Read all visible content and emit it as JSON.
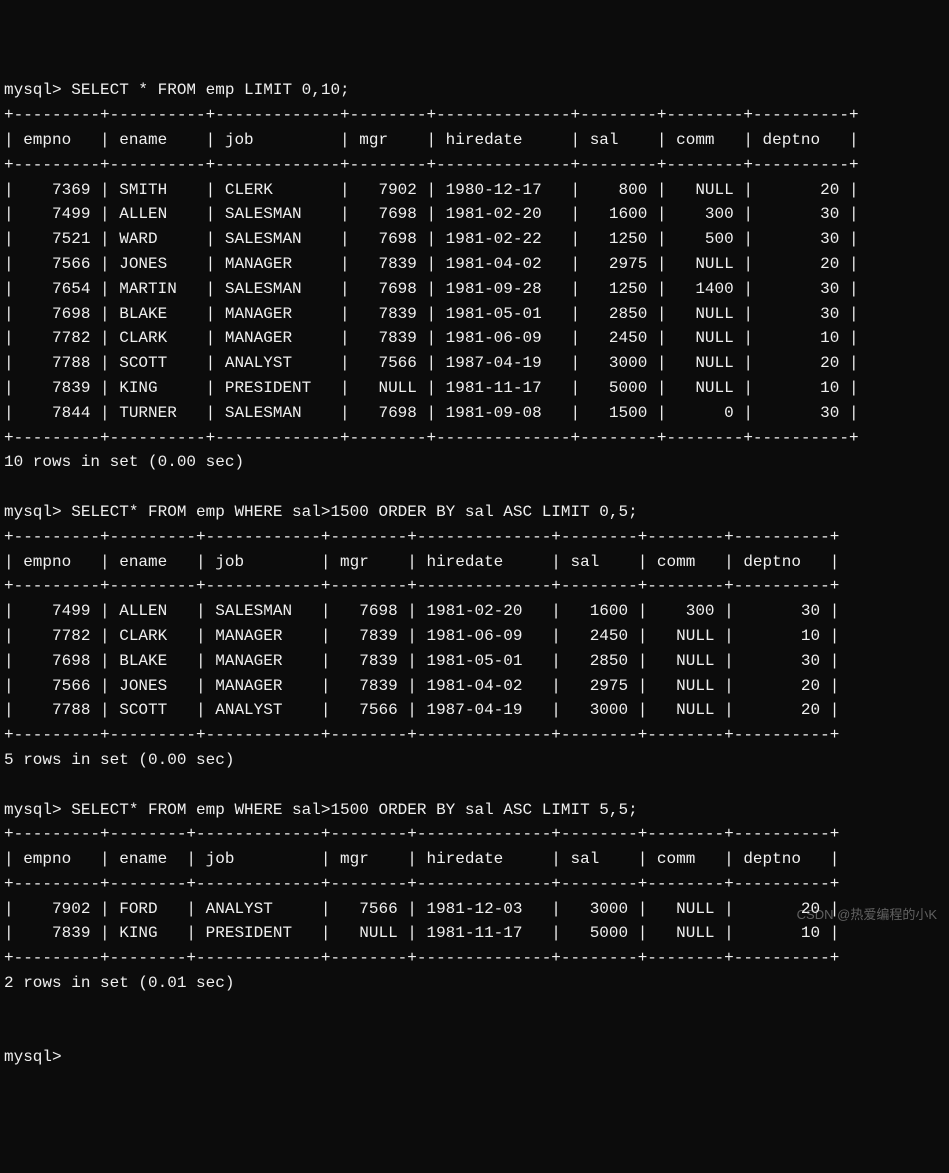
{
  "prompt": "mysql>",
  "queries": [
    {
      "sql": "SELECT * FROM emp LIMIT 0,10;",
      "headers": [
        "empno",
        "ename",
        "job",
        "mgr",
        "hiredate",
        "sal",
        "comm",
        "deptno"
      ],
      "widths": [
        7,
        8,
        11,
        6,
        12,
        6,
        6,
        8
      ],
      "aligns": [
        "r",
        "l",
        "l",
        "r",
        "l",
        "r",
        "r",
        "r"
      ],
      "rows": [
        [
          "7369",
          "SMITH",
          "CLERK",
          "7902",
          "1980-12-17",
          "800",
          "NULL",
          "20"
        ],
        [
          "7499",
          "ALLEN",
          "SALESMAN",
          "7698",
          "1981-02-20",
          "1600",
          "300",
          "30"
        ],
        [
          "7521",
          "WARD",
          "SALESMAN",
          "7698",
          "1981-02-22",
          "1250",
          "500",
          "30"
        ],
        [
          "7566",
          "JONES",
          "MANAGER",
          "7839",
          "1981-04-02",
          "2975",
          "NULL",
          "20"
        ],
        [
          "7654",
          "MARTIN",
          "SALESMAN",
          "7698",
          "1981-09-28",
          "1250",
          "1400",
          "30"
        ],
        [
          "7698",
          "BLAKE",
          "MANAGER",
          "7839",
          "1981-05-01",
          "2850",
          "NULL",
          "30"
        ],
        [
          "7782",
          "CLARK",
          "MANAGER",
          "7839",
          "1981-06-09",
          "2450",
          "NULL",
          "10"
        ],
        [
          "7788",
          "SCOTT",
          "ANALYST",
          "7566",
          "1987-04-19",
          "3000",
          "NULL",
          "20"
        ],
        [
          "7839",
          "KING",
          "PRESIDENT",
          "NULL",
          "1981-11-17",
          "5000",
          "NULL",
          "10"
        ],
        [
          "7844",
          "TURNER",
          "SALESMAN",
          "7698",
          "1981-09-08",
          "1500",
          "0",
          "30"
        ]
      ],
      "footer": "10 rows in set (0.00 sec)"
    },
    {
      "sql": "SELECT* FROM emp WHERE sal>1500 ORDER BY sal ASC LIMIT 0,5;",
      "headers": [
        "empno",
        "ename",
        "job",
        "mgr",
        "hiredate",
        "sal",
        "comm",
        "deptno"
      ],
      "widths": [
        7,
        7,
        10,
        6,
        12,
        6,
        6,
        8
      ],
      "aligns": [
        "r",
        "l",
        "l",
        "r",
        "l",
        "r",
        "r",
        "r"
      ],
      "rows": [
        [
          "7499",
          "ALLEN",
          "SALESMAN",
          "7698",
          "1981-02-20",
          "1600",
          "300",
          "30"
        ],
        [
          "7782",
          "CLARK",
          "MANAGER",
          "7839",
          "1981-06-09",
          "2450",
          "NULL",
          "10"
        ],
        [
          "7698",
          "BLAKE",
          "MANAGER",
          "7839",
          "1981-05-01",
          "2850",
          "NULL",
          "30"
        ],
        [
          "7566",
          "JONES",
          "MANAGER",
          "7839",
          "1981-04-02",
          "2975",
          "NULL",
          "20"
        ],
        [
          "7788",
          "SCOTT",
          "ANALYST",
          "7566",
          "1987-04-19",
          "3000",
          "NULL",
          "20"
        ]
      ],
      "footer": "5 rows in set (0.00 sec)"
    },
    {
      "sql": "SELECT* FROM emp WHERE sal>1500 ORDER BY sal ASC LIMIT 5,5;",
      "headers": [
        "empno",
        "ename",
        "job",
        "mgr",
        "hiredate",
        "sal",
        "comm",
        "deptno"
      ],
      "widths": [
        7,
        6,
        11,
        6,
        12,
        6,
        6,
        8
      ],
      "aligns": [
        "r",
        "l",
        "l",
        "r",
        "l",
        "r",
        "r",
        "r"
      ],
      "rows": [
        [
          "7902",
          "FORD",
          "ANALYST",
          "7566",
          "1981-12-03",
          "3000",
          "NULL",
          "20"
        ],
        [
          "7839",
          "KING",
          "PRESIDENT",
          "NULL",
          "1981-11-17",
          "5000",
          "NULL",
          "10"
        ]
      ],
      "footer": "2 rows in set (0.01 sec)"
    }
  ],
  "watermark": "CSDN @热爱编程的小K"
}
